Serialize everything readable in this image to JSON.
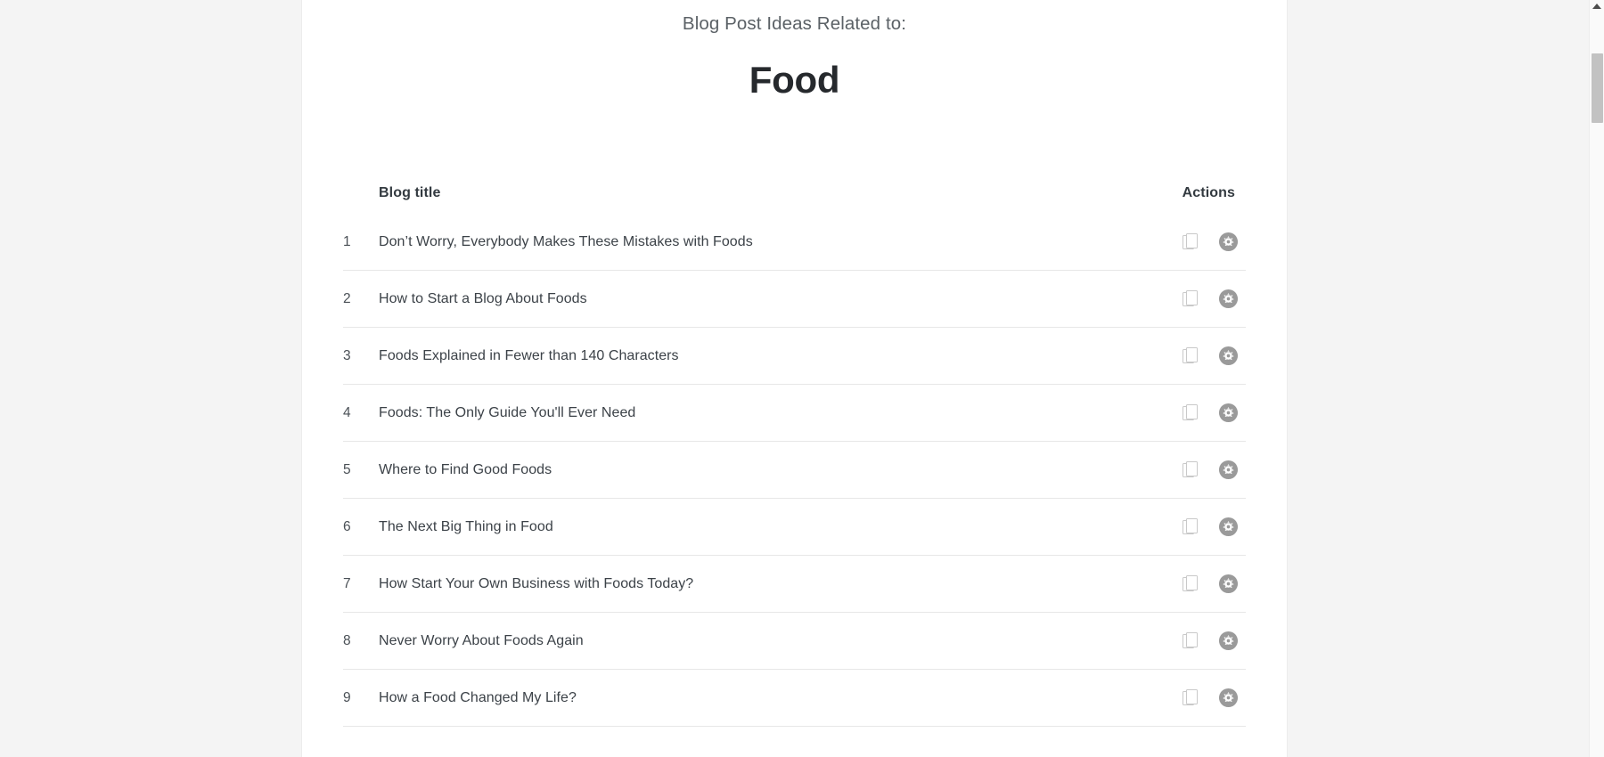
{
  "page": {
    "background_color": "#f4f4f4",
    "card_background": "#ffffff"
  },
  "header": {
    "eyebrow": "Blog Post Ideas Related to:",
    "topic": "Food"
  },
  "table": {
    "columns": {
      "index": "",
      "title": "Blog title",
      "actions": "Actions"
    },
    "rows": [
      {
        "index": "1",
        "title": "Don’t Worry, Everybody Makes These Mistakes with Foods"
      },
      {
        "index": "2",
        "title": "How to Start a Blog About Foods"
      },
      {
        "index": "3",
        "title": "Foods Explained in Fewer than 140 Characters"
      },
      {
        "index": "4",
        "title": "Foods: The Only Guide You'll Ever Need"
      },
      {
        "index": "5",
        "title": "Where to Find Good Foods"
      },
      {
        "index": "6",
        "title": "The Next Big Thing in Food"
      },
      {
        "index": "7",
        "title": "How Start Your Own Business with Foods Today?"
      },
      {
        "index": "8",
        "title": "Never Worry About Foods Again"
      },
      {
        "index": "9",
        "title": "How a Food Changed My Life?"
      }
    ],
    "row_actions": {
      "copy_icon": "copy-icon",
      "settings_icon": "gear-icon"
    }
  },
  "scrollbar": {
    "up_arrow_icon": "caret-up-icon",
    "track_color": "#fafafa",
    "thumb_color": "#c2c2c2"
  }
}
